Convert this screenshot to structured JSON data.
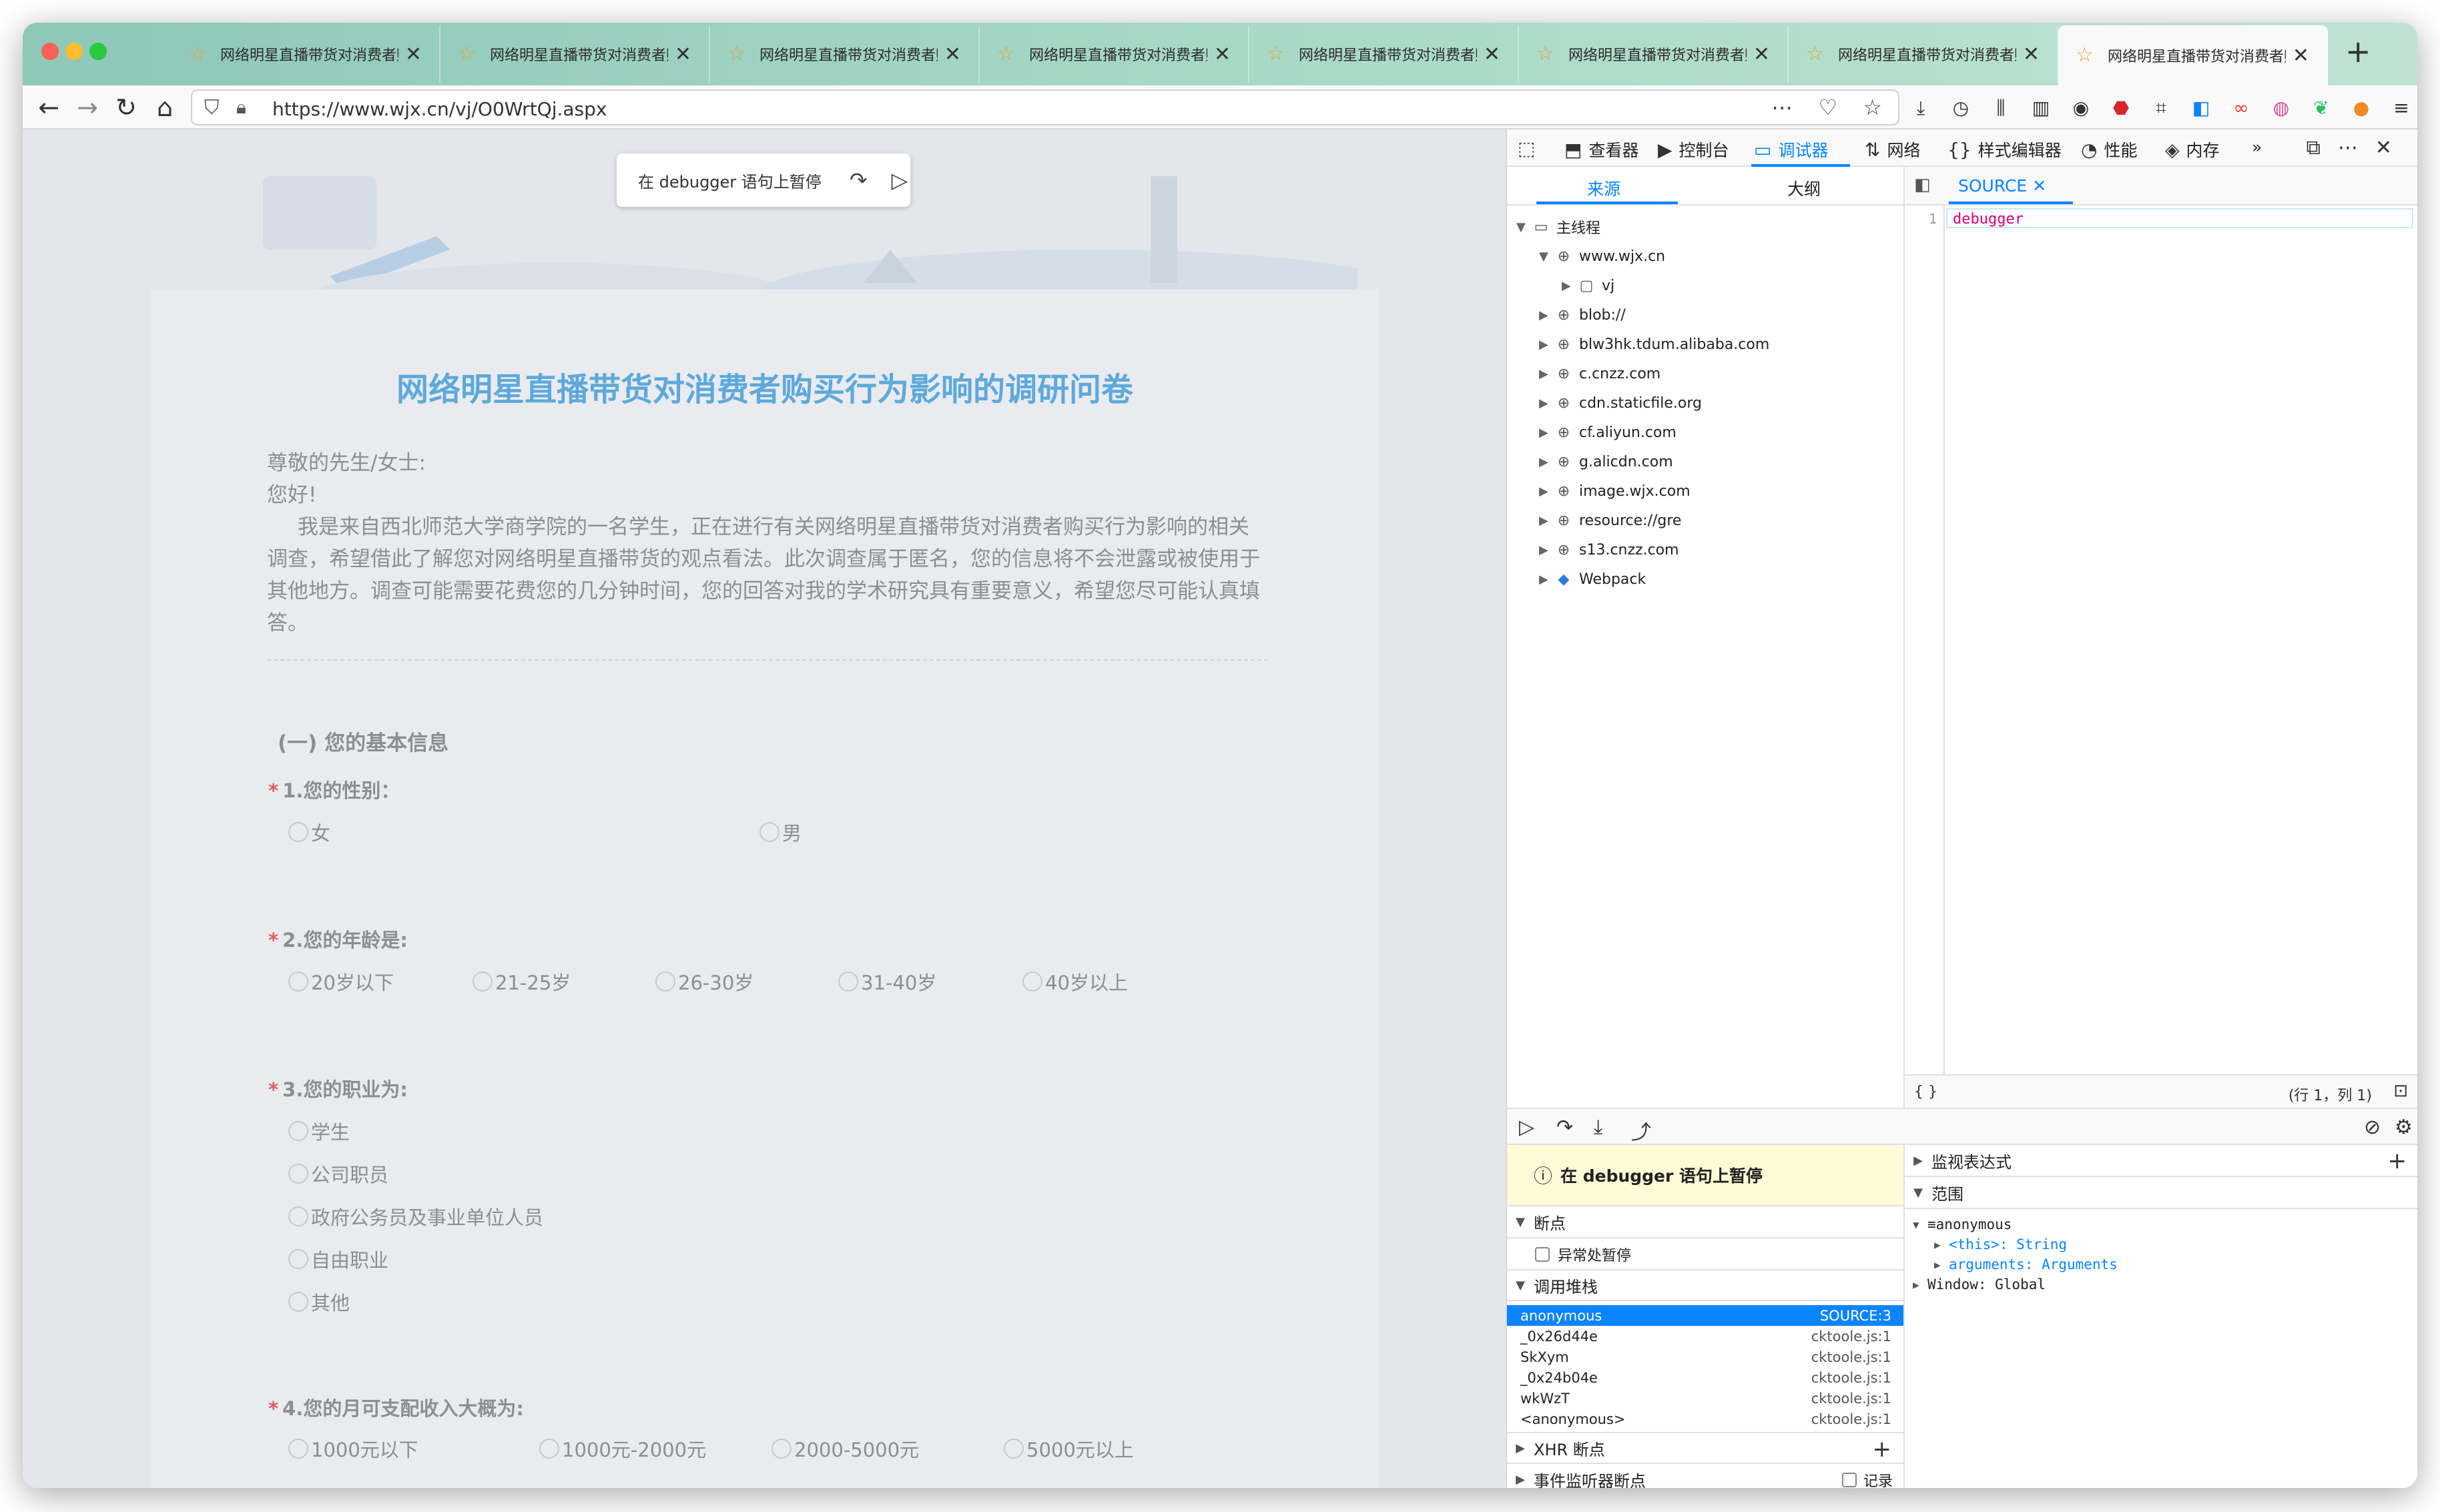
{
  "browser": {
    "tabs": [
      {
        "title": "网络明星直播带货对消费者购",
        "active": false
      },
      {
        "title": "网络明星直播带货对消费者购",
        "active": false
      },
      {
        "title": "网络明星直播带货对消费者购",
        "active": false
      },
      {
        "title": "网络明星直播带货对消费者购",
        "active": false
      },
      {
        "title": "网络明星直播带货对消费者购",
        "active": false
      },
      {
        "title": "网络明星直播带货对消费者购",
        "active": false
      },
      {
        "title": "网络明星直播带货对消费者购",
        "active": false
      },
      {
        "title": "网络明星直播带货对消费者购",
        "active": true
      }
    ],
    "url": "https://www.wjx.cn/vj/O0WrtQj.aspx",
    "url_icons": "⋯ ♡ ☆"
  },
  "page": {
    "paused_pill": "在 debugger 语句上暂停",
    "survey_title": "网络明星直播带货对消费者购买行为影响的调研问卷",
    "intro": {
      "greeting": "尊敬的先生/女士:",
      "hello": "您好!",
      "body": "我是来自西北师范大学商学院的一名学生，正在进行有关网络明星直播带货对消费者购买行为影响的相关调查，希望借此了解您对网络明星直播带货的观点看法。此次调查属于匿名，您的信息将不会泄露或被使用于其他地方。调查可能需要花费您的几分钟时间，您的回答对我的学术研究具有重要意义，希望您尽可能认真填答。"
    },
    "section_title": "(一) 您的基本信息",
    "questions": [
      {
        "label": "1.您的性别：",
        "options": [
          "女",
          "男"
        ]
      },
      {
        "label": "2.您的年龄是:",
        "options": [
          "20岁以下",
          "21-25岁",
          "26-30岁",
          "31-40岁",
          "40岁以上"
        ]
      },
      {
        "label": "3.您的职业为:",
        "options": [
          "学生",
          "公司职员",
          "政府公务员及事业单位人员",
          "自由职业",
          "其他"
        ]
      },
      {
        "label": "4.您的月可支配收入大概为:",
        "options": [
          "1000元以下",
          "1000元-2000元",
          "2000-5000元",
          "5000元以上"
        ]
      }
    ],
    "required_mark": "*"
  },
  "devtools": {
    "tabs": [
      "查看器",
      "控制台",
      "调试器",
      "网络",
      "样式编辑器",
      "性能",
      "内存"
    ],
    "active_tab": "调试器",
    "source_tabs": [
      "来源",
      "大纲"
    ],
    "tree": [
      {
        "label": "主线程",
        "icon": "window-icon",
        "depth": 0,
        "expanded": true
      },
      {
        "label": "www.wjx.cn",
        "icon": "globe-icon",
        "depth": 1,
        "expanded": true
      },
      {
        "label": "vj",
        "icon": "folder-icon",
        "depth": 2,
        "expanded": false
      },
      {
        "label": "blob://",
        "icon": "globe-icon",
        "depth": 1,
        "expanded": false
      },
      {
        "label": "blw3hk.tdum.alibaba.com",
        "icon": "globe-icon",
        "depth": 1,
        "expanded": false
      },
      {
        "label": "c.cnzz.com",
        "icon": "globe-icon",
        "depth": 1,
        "expanded": false
      },
      {
        "label": "cdn.staticfile.org",
        "icon": "globe-icon",
        "depth": 1,
        "expanded": false
      },
      {
        "label": "cf.aliyun.com",
        "icon": "globe-icon",
        "depth": 1,
        "expanded": false
      },
      {
        "label": "g.alicdn.com",
        "icon": "globe-icon",
        "depth": 1,
        "expanded": false
      },
      {
        "label": "image.wjx.com",
        "icon": "globe-icon",
        "depth": 1,
        "expanded": false
      },
      {
        "label": "resource://gre",
        "icon": "globe-icon",
        "depth": 1,
        "expanded": false
      },
      {
        "label": "s13.cnzz.com",
        "icon": "globe-icon",
        "depth": 1,
        "expanded": false
      },
      {
        "label": "Webpack",
        "icon": "webpack-icon",
        "depth": 1,
        "expanded": false
      }
    ],
    "editor": {
      "tab": "SOURCE",
      "line_number": "1",
      "code": "debugger",
      "footer_left": "{ }",
      "footer_position": "(行 1，列 1)"
    },
    "debugger": {
      "paused_banner": "在 debugger 语句上暂停",
      "breakpoints_label": "断点",
      "pause_on_exceptions": "异常处暂停",
      "callstack_label": "调用堆栈",
      "frames": [
        {
          "name": "anonymous",
          "location": "SOURCE:3",
          "selected": true
        },
        {
          "name": "_0x26d44e",
          "location": "cktoole.js:1",
          "selected": false
        },
        {
          "name": "SkXym",
          "location": "cktoole.js:1",
          "selected": false
        },
        {
          "name": "_0x24b04e",
          "location": "cktoole.js:1",
          "selected": false
        },
        {
          "name": "wkWzT",
          "location": "cktoole.js:1",
          "selected": false
        },
        {
          "name": "<anonymous>",
          "location": "cktoole.js:1",
          "selected": false
        }
      ],
      "xhr_breakpoints": "XHR 断点",
      "event_listener_breakpoints": "事件监听器断点",
      "record_label": "记录",
      "watch_label": "监视表达式",
      "scope_label": "范围",
      "scope": {
        "fn": "anonymous",
        "this_key": "<this>:",
        "this_val": "String",
        "args_key": "arguments:",
        "args_val": "Arguments",
        "window": "Window: Global"
      }
    }
  }
}
